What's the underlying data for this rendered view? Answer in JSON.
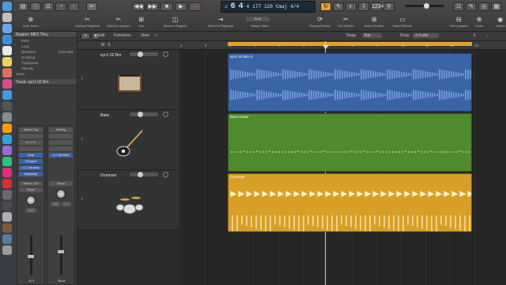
{
  "dock": {
    "apps": [
      {
        "name": "finder-icon",
        "color": "#4a9be0"
      },
      {
        "name": "launchpad-icon",
        "color": "#c0c0c0"
      },
      {
        "name": "mail-icon",
        "color": "#6aa7e8"
      },
      {
        "name": "safari-icon",
        "color": "#3f8fd8"
      },
      {
        "name": "calendar-icon",
        "color": "#e8e8e8"
      },
      {
        "name": "notes-icon",
        "color": "#f2d25c"
      },
      {
        "name": "photos-icon",
        "color": "#e06f58"
      },
      {
        "name": "itunes-icon",
        "color": "#d94f8a"
      },
      {
        "name": "appstore-icon",
        "color": "#3f9de0"
      },
      {
        "name": "logic-icon",
        "color": "#555555"
      },
      {
        "name": "settings-icon",
        "color": "#8a8a8a"
      },
      {
        "name": "illustrator-icon",
        "color": "#ff9a00"
      },
      {
        "name": "photoshop-icon",
        "color": "#2fa3e0"
      },
      {
        "name": "premiere-icon",
        "color": "#9a6bd8"
      },
      {
        "name": "audition-icon",
        "color": "#2ac47a"
      },
      {
        "name": "indesign-icon",
        "color": "#e0307a"
      },
      {
        "name": "acrobat-icon",
        "color": "#d83030"
      },
      {
        "name": "app-icon-18",
        "color": "#6a6a6a"
      },
      {
        "name": "app-icon-19",
        "color": "#4a4a4a"
      },
      {
        "name": "app-icon-20",
        "color": "#b0b0b0"
      },
      {
        "name": "app-icon-21",
        "color": "#7a5a3a"
      },
      {
        "name": "app-icon-22",
        "color": "#5a7aa0"
      },
      {
        "name": "trash-icon",
        "color": "#9a9a9a"
      }
    ]
  },
  "toolbar": {
    "lcd": {
      "bar": "6",
      "beat": "4",
      "tempo_bar": "4",
      "bpm_lead": "177",
      "tempo": "120",
      "key": "Cmaj",
      "time_sig": "4/4"
    },
    "tools": [
      {
        "label": "Auto Zoom",
        "icon": "⊕"
      },
      {
        "label": "Split by Playhead",
        "icon": "✂"
      },
      {
        "label": "Split by Locators",
        "icon": "✂"
      },
      {
        "label": "Join",
        "icon": "⊞"
      },
      {
        "label": "Bounce Regions",
        "icon": "◫"
      },
      {
        "label": "Move to Playhead",
        "icon": "⇥"
      },
      {
        "label": "Nudge Value",
        "icon": "◂▸"
      },
      {
        "label": "Repeat Section",
        "icon": "⟳"
      },
      {
        "label": "Cut Section",
        "icon": "✂"
      },
      {
        "label": "Insert Section",
        "icon": "⊞"
      },
      {
        "label": "Insert Silence",
        "icon": "▭"
      },
      {
        "label": "Set Locators",
        "icon": "⊟"
      },
      {
        "label": "Zoom",
        "icon": "⊕"
      },
      {
        "label": "Colors",
        "icon": "◉"
      }
    ],
    "nudge_value": "Beat"
  },
  "inspector": {
    "region_header": "Region: MIDI Thru",
    "rows": [
      {
        "label": "Mute",
        "value": ""
      },
      {
        "label": "Loop",
        "value": ""
      },
      {
        "label": "Quantize",
        "value": "1/16 Note"
      },
      {
        "label": "Q-Swing",
        "value": ""
      },
      {
        "label": "Transpose",
        "value": ""
      },
      {
        "label": "Velocity",
        "value": ""
      }
    ],
    "more": "More",
    "track_header": "Track: syn1 02 Bm",
    "left_strip": {
      "chips": [
        "Warm Org",
        "",
        "In 1+2",
        ""
      ],
      "inserts": [
        "Amp",
        "TsTape2",
        "LI-I Ultrama",
        "Simplicity"
      ],
      "out": "Stereo Out",
      "mode": "Read",
      "value": "0.4",
      "bottom": "M  S"
    },
    "right_strip": {
      "chips": [
        "Setting",
        "",
        "",
        ""
      ],
      "inserts": [
        "LI-I Ultrama"
      ],
      "mode": "Read",
      "value": "0.0",
      "value2": "-0.2",
      "name": "Bnce"
    }
  },
  "tracks_menu": {
    "edit": "Edit",
    "functions": "Functions",
    "view": "View",
    "snap_label": "Snap:",
    "snap_value": "Bar",
    "drag_label": "Drag:",
    "drag_value": "X-Fade"
  },
  "tracks": [
    {
      "number": "1",
      "name": "syn1 02 Bm",
      "icon": "amp-icon"
    },
    {
      "number": "2",
      "name": "Bass",
      "icon": "bass-guitar-icon"
    },
    {
      "number": "3",
      "name": "Drummer",
      "icon": "drum-kit-icon"
    }
  ],
  "ruler": {
    "marks": [
      "1",
      "2",
      "3",
      "4",
      "5",
      "6",
      "7",
      "8",
      "9",
      "10",
      "11",
      "12",
      "13"
    ]
  },
  "regions": [
    {
      "label": "syn1 02 Bm  ⊙",
      "color": "#3a64a8",
      "wave": "#8fb3ea"
    },
    {
      "label": "Bass Guitar",
      "color": "#4f8a2c",
      "wave": "#b6e08a"
    },
    {
      "label": "Drummer",
      "color": "#d89f26",
      "wave": "#fff2c8"
    }
  ]
}
